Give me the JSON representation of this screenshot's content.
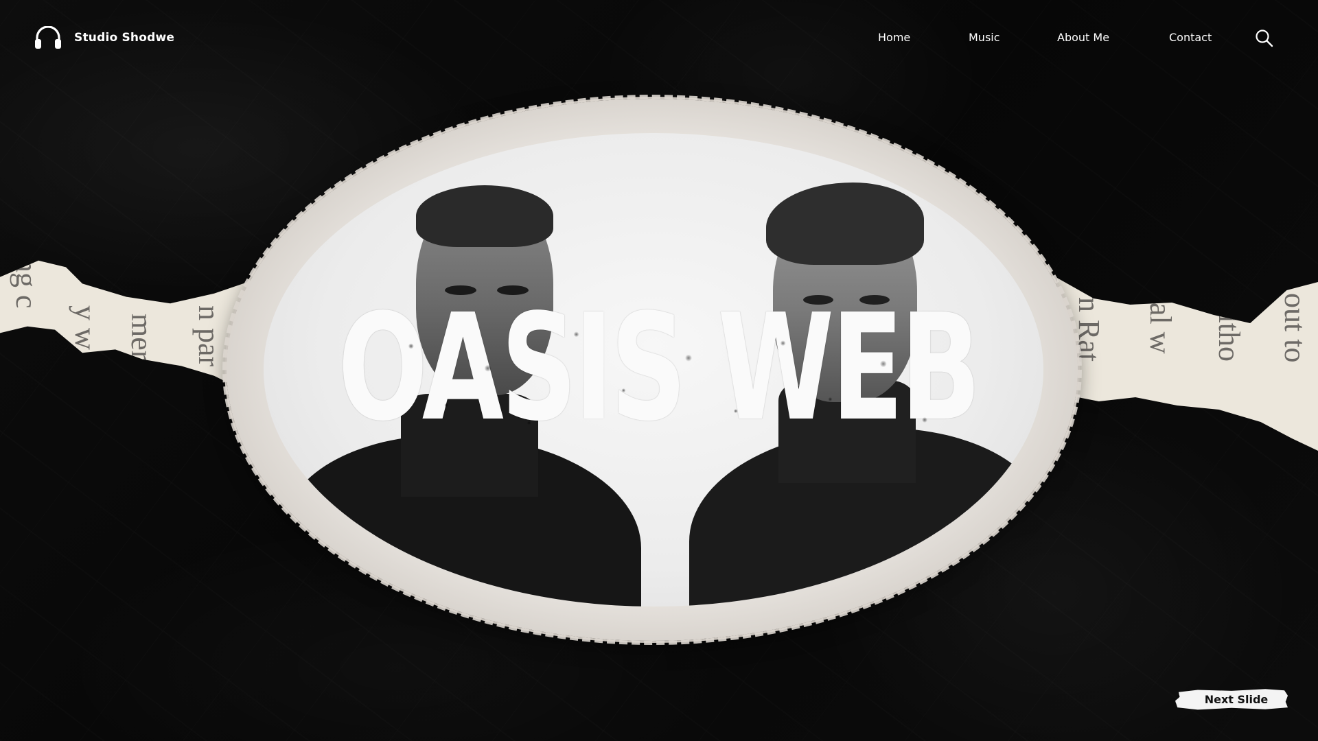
{
  "brand": {
    "name": "Studio Shodwe",
    "icon": "headphones-icon"
  },
  "nav": {
    "items": [
      {
        "label": "Home"
      },
      {
        "label": "Music"
      },
      {
        "label": "About Me"
      },
      {
        "label": "Contact"
      }
    ],
    "search_icon": "search-icon"
  },
  "hero": {
    "title": "OASIS WEB"
  },
  "newspaper": {
    "left_lines": [
      "ng c",
      "y w",
      "mer",
      "n par"
    ],
    "right_lines": [
      "n Rat",
      "al w",
      "altho",
      "out to"
    ]
  },
  "cta": {
    "next_label": "Next Slide"
  },
  "colors": {
    "background": "#0a0a0a",
    "paper": "#ece7dc",
    "frame": "#e6e2dd",
    "title": "#fafafa",
    "button": "#f4f4f4"
  }
}
